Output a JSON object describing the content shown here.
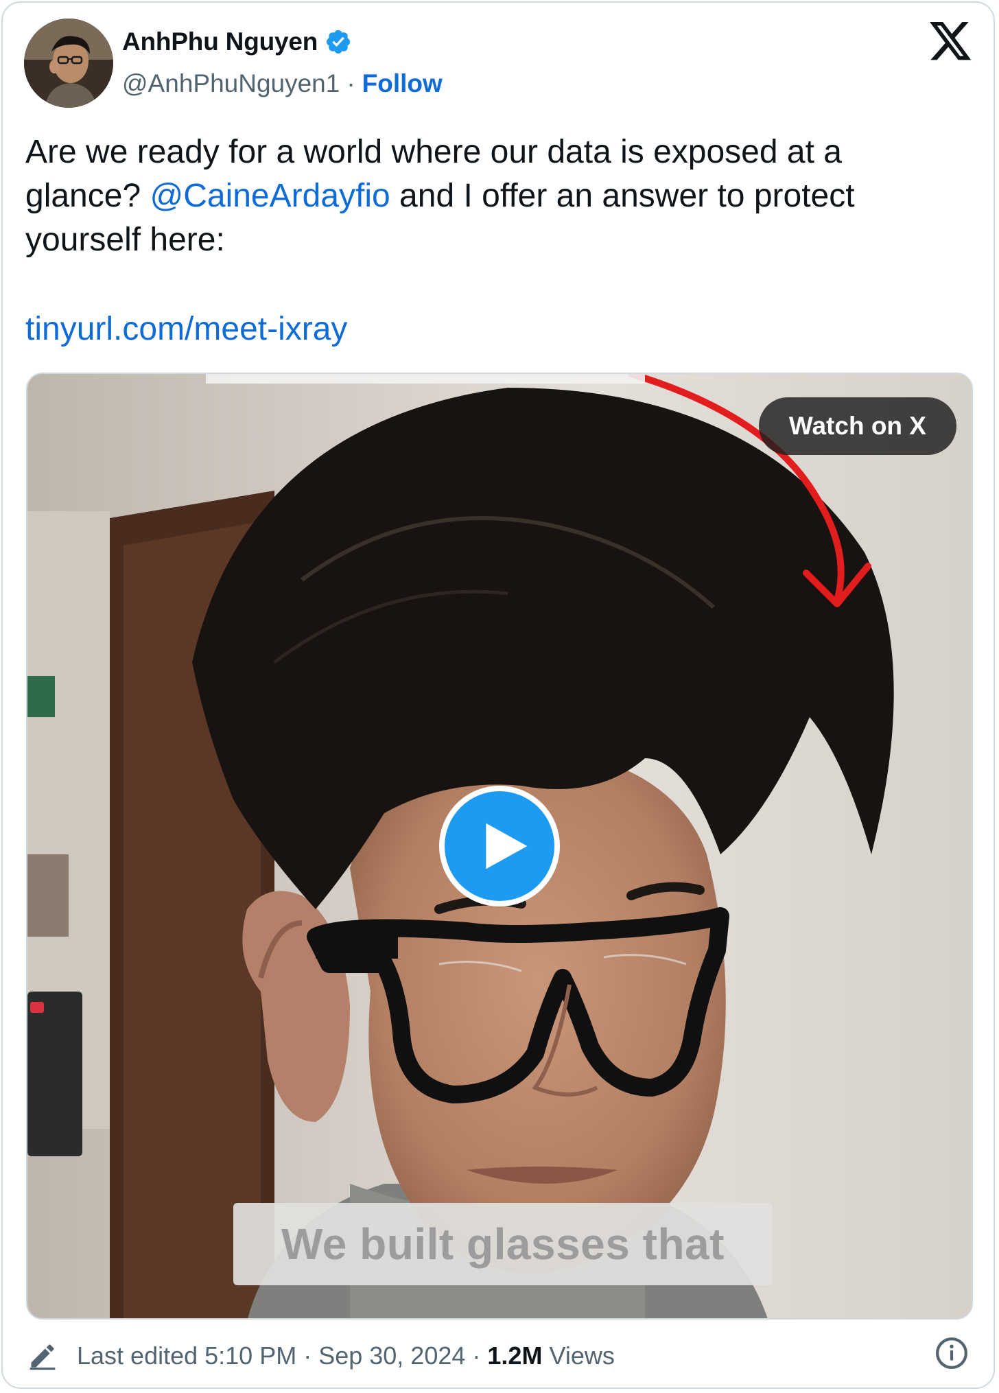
{
  "author": {
    "display_name": "AnhPhu Nguyen",
    "handle": "@AnhPhuNguyen1",
    "separator": "·",
    "follow_label": "Follow",
    "verified_icon": "verified-badge-icon"
  },
  "tweet": {
    "text_before": "Are we ready for a world where our data is exposed at a glance? ",
    "mention": "@CaineArdayfio",
    "text_after": " and I offer an answer to protect yourself here:",
    "link": "tinyurl.com/meet-ixray"
  },
  "media": {
    "watch_label": "Watch on X",
    "caption": "We built glasses that",
    "play_icon": "play-icon"
  },
  "footer": {
    "edited_label": "Last edited 5:10 PM",
    "separator": "·",
    "date": "Sep 30, 2024",
    "views_count": "1.2M",
    "views_label": "Views"
  },
  "colors": {
    "link_blue": "#0f6bd6",
    "play_blue": "#1d9bf0",
    "text_dark": "#0f1419",
    "text_gray": "#536471",
    "border": "#cfd9de"
  }
}
